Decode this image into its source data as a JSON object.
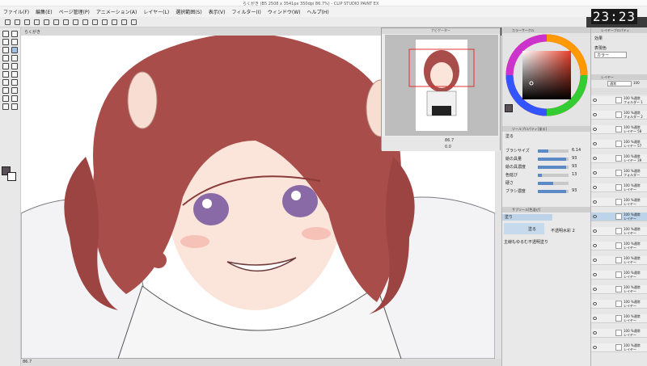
{
  "window": {
    "title": "らくがき (B5 2508 x 3541px 350dpi 86.7%) - CLIP STUDIO PAINT EX",
    "clock": "23:23",
    "accent": "#3aa5e6"
  },
  "menu": [
    "ファイル(F)",
    "編集(E)",
    "ページ管理(P)",
    "アニメーション(A)",
    "レイヤー(L)",
    "選択範囲(S)",
    "表示(V)",
    "フィルター(I)",
    "ウィンドウ(W)",
    "ヘルプ(H)"
  ],
  "canvas_tab": "らくがき",
  "navigator": {
    "header": "ナビゲーター",
    "zoom": "86.7",
    "angle": "0.0"
  },
  "color_panel": {
    "header": "カラーサークル"
  },
  "tool_property": {
    "header": "ツールプロパティ[塗る]",
    "tool_name": "塗る",
    "rows": [
      {
        "label": "ブラシサイズ",
        "value": "6.14",
        "level": 0.35
      },
      {
        "label": "絵の具量",
        "value": "93",
        "level": 0.93
      },
      {
        "label": "絵の具濃度",
        "value": "93",
        "level": 0.93
      },
      {
        "label": "色延び",
        "value": "13",
        "level": 0.13
      },
      {
        "label": "硬さ",
        "value": "",
        "level": 0.5
      },
      {
        "label": "ブラシ濃度",
        "value": "93",
        "level": 0.93
      }
    ]
  },
  "sub_tool": {
    "header": "サブツール[色混ぜ]",
    "group": "塗り",
    "items": [
      "塗る",
      "不透明水彩 2",
      "主線もゆるむ不透明塗り"
    ]
  },
  "layer_property": {
    "header": "レイヤープロパティ",
    "effect_label": "効果",
    "expression_label": "表現色",
    "expression_value": "カラー"
  },
  "layers": {
    "header": "レイヤー",
    "blend": "通常",
    "opacity": "100",
    "rows": [
      {
        "pct": "100 %通常",
        "name": "フォルダー 1"
      },
      {
        "pct": "100 %通常",
        "name": "フォルダー 2"
      },
      {
        "pct": "100 %通常",
        "name": "レイヤー 58"
      },
      {
        "pct": "100 %通常",
        "name": "レイヤー 57"
      },
      {
        "pct": "100 %通常",
        "name": "レイヤー 39"
      },
      {
        "pct": "100 %通常",
        "name": "フォルダー"
      },
      {
        "pct": "100 %通常",
        "name": "レイヤー"
      },
      {
        "pct": "100 %通常",
        "name": "レイヤー"
      },
      {
        "pct": "100 %通常",
        "name": "レイヤー"
      },
      {
        "pct": "100 %通常",
        "name": "レイヤー"
      },
      {
        "pct": "100 %通常",
        "name": "レイヤー"
      },
      {
        "pct": "100 %通常",
        "name": "レイヤー"
      },
      {
        "pct": "100 %通常",
        "name": "レイヤー"
      },
      {
        "pct": "100 %通常",
        "name": "レイヤー"
      },
      {
        "pct": "100 %通常",
        "name": "レイヤー"
      },
      {
        "pct": "100 %通常",
        "name": "レイヤー"
      },
      {
        "pct": "100 %通常",
        "name": "レイヤー"
      },
      {
        "pct": "100 %通常",
        "name": "レイヤー"
      }
    ]
  },
  "status": {
    "zoom": "86.7"
  }
}
